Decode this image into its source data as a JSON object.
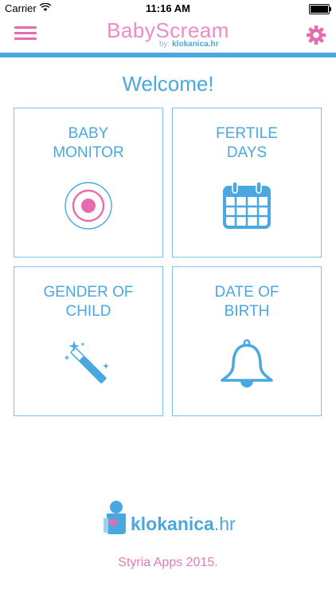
{
  "status_bar": {
    "carrier": "Carrier",
    "time": "11:16 AM"
  },
  "nav": {
    "title": "BabyScream",
    "byline_prefix": "by:",
    "byline_brand": "klokanica.hr",
    "menu_icon": "hamburger-icon",
    "settings_icon": "gear-icon"
  },
  "welcome": "Welcome!",
  "tiles": [
    {
      "line1": "BABY",
      "line2": "MONITOR",
      "icon": "record-icon"
    },
    {
      "line1": "FERTILE",
      "line2": "DAYS",
      "icon": "calendar-icon"
    },
    {
      "line1": "GENDER OF",
      "line2": "CHILD",
      "icon": "magic-wand-icon"
    },
    {
      "line1": "DATE OF",
      "line2": "BIRTH",
      "icon": "bell-icon"
    }
  ],
  "footer": {
    "brand": "klokanica",
    "brand_tld": ".hr",
    "copyright": "Styria Apps 2015."
  },
  "colors": {
    "pink": "#e86bb0",
    "blue": "#4aa8e0",
    "tile_border": "#7cc3ea"
  }
}
